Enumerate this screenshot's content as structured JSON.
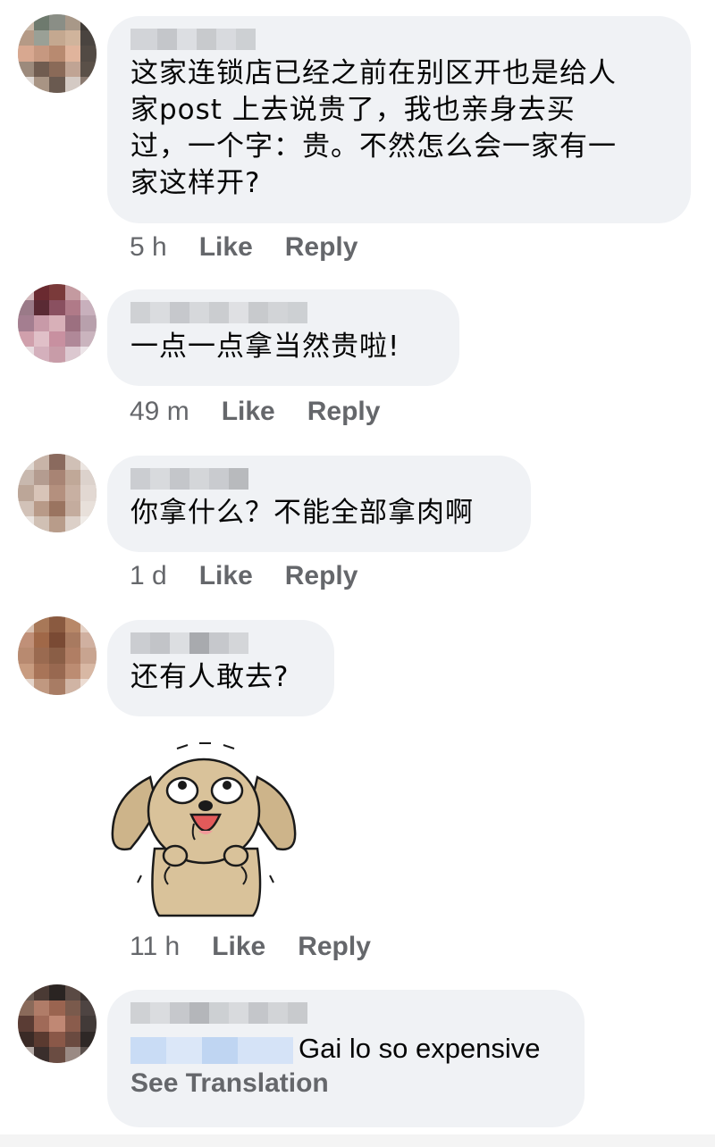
{
  "comments": [
    {
      "text_lines": [
        "这家连锁店已经之前在别区开也是给人",
        "家post 上去说贵了，我也亲身去买",
        "过，一个字：贵。不然怎么会一家有一",
        "家这样开?"
      ],
      "time": "5 h",
      "like": "Like",
      "reply": "Reply"
    },
    {
      "text_lines": [
        "一点一点拿当然贵啦!"
      ],
      "time": "49 m",
      "like": "Like",
      "reply": "Reply"
    },
    {
      "text_lines": [
        "你拿什么？不能全部拿肉啊"
      ],
      "time": "1 d",
      "like": "Like",
      "reply": "Reply"
    },
    {
      "text_lines": [
        "还有人敢去?"
      ],
      "time": "11 h",
      "like": "Like",
      "reply": "Reply"
    },
    {
      "text": "Gai lo so expensive",
      "see_translation": "See Translation"
    }
  ],
  "colors": {
    "bubble": "#f0f2f5",
    "meta_text": "#65676b",
    "mention": "#c9dcf5"
  },
  "icons": {
    "sticker": "puppy-sticker-icon"
  }
}
